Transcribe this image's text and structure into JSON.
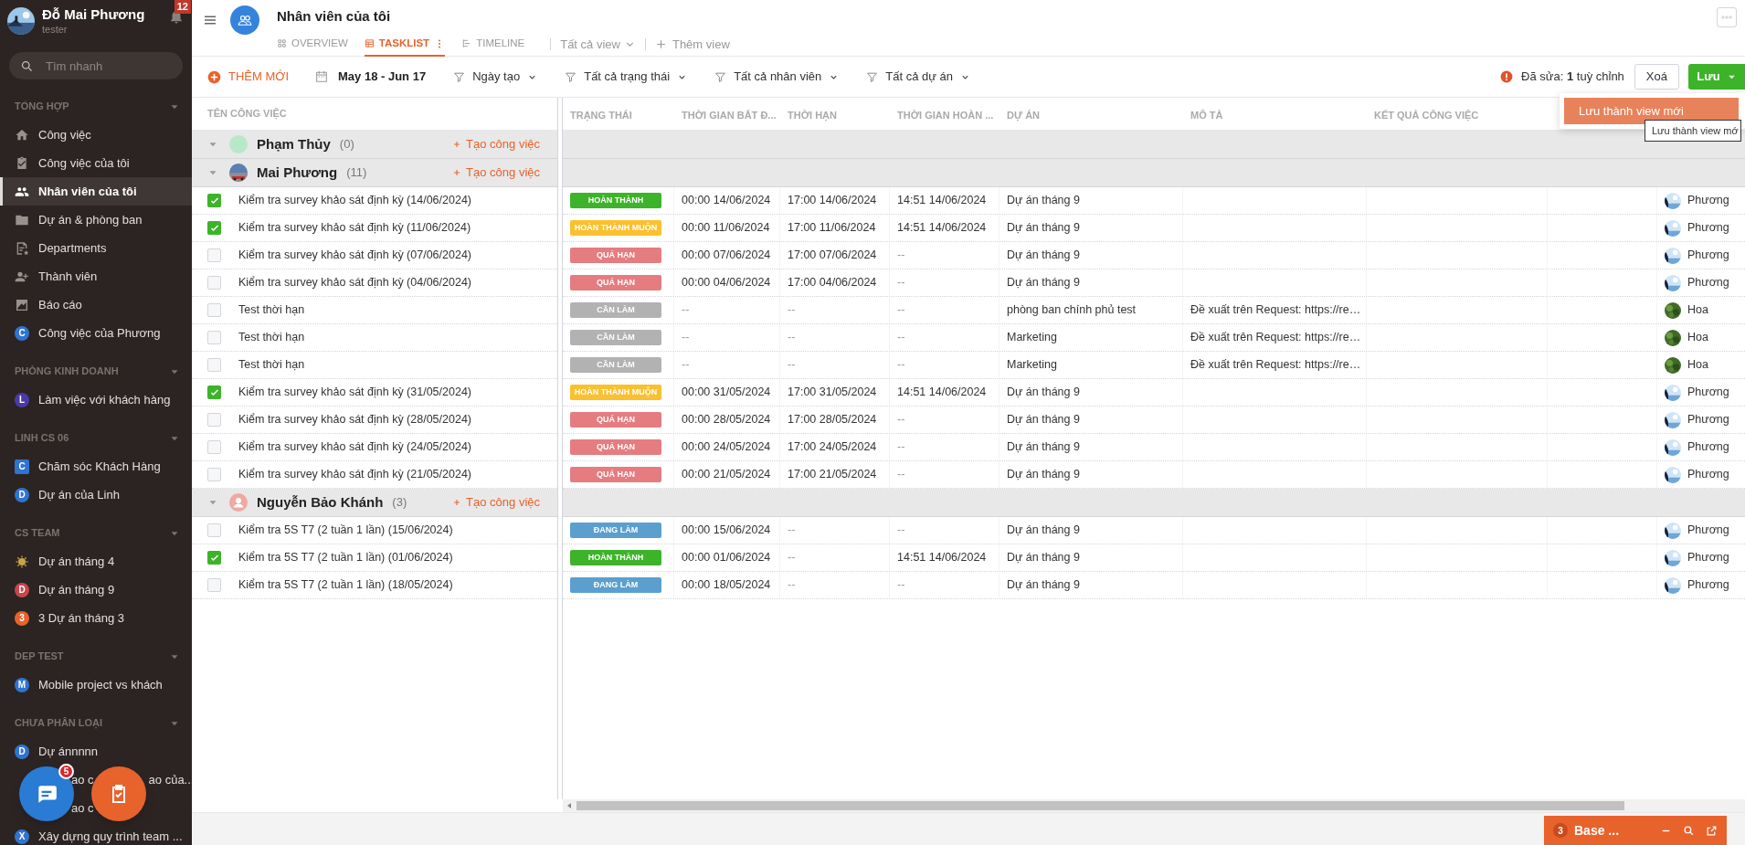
{
  "sidebar": {
    "user": {
      "name": "Đỗ Mai Phương",
      "role": "tester"
    },
    "notifications": "12",
    "search": {
      "placeholder": "Tìm nhanh"
    },
    "sections": [
      {
        "title": "TỔNG HỢP",
        "expanded": true,
        "items": [
          {
            "kind": "icon",
            "label": "Công việc",
            "selected": false
          },
          {
            "kind": "icon",
            "label": "Công việc của tôi",
            "selected": false
          },
          {
            "kind": "icon",
            "label": "Nhân viên của tôi",
            "selected": true
          },
          {
            "kind": "icon",
            "label": "Dự án & phòng ban",
            "selected": false
          },
          {
            "kind": "icon",
            "label": "Departments",
            "selected": false
          },
          {
            "kind": "icon",
            "label": "Thành viên",
            "selected": false
          },
          {
            "kind": "icon",
            "label": "Báo cáo",
            "selected": false
          },
          {
            "kind": "letter",
            "letter": "C",
            "color": "#2f74d0",
            "label": "Công việc của Phương",
            "selected": false
          }
        ]
      },
      {
        "title": "PHÒNG KINH DOANH",
        "expanded": true,
        "items": [
          {
            "kind": "letter",
            "letter": "L",
            "color": "#4a3aa8",
            "label": "Làm việc với khách hàng",
            "selected": false
          }
        ]
      },
      {
        "title": "LINH CS 06",
        "expanded": true,
        "items": [
          {
            "kind": "square",
            "letter": "C",
            "color": "#2f74d0",
            "label": "Chăm sóc Khách Hàng",
            "selected": false
          },
          {
            "kind": "letter",
            "letter": "D",
            "color": "#2f74d0",
            "label": "Dự án của Linh",
            "selected": false
          }
        ]
      },
      {
        "title": "CS TEAM",
        "expanded": true,
        "items": [
          {
            "kind": "sun",
            "label": "Dự án tháng 4",
            "selected": false
          },
          {
            "kind": "letter",
            "letter": "D",
            "color": "#c8464b",
            "label": "Dự án tháng 9",
            "selected": false
          },
          {
            "kind": "letter",
            "letter": "3",
            "color": "#e8622c",
            "label": "3 Dự án tháng 3",
            "selected": false
          }
        ]
      },
      {
        "title": "DEP TEST",
        "expanded": true,
        "items": [
          {
            "kind": "letter",
            "letter": "M",
            "color": "#2f74d0",
            "label": "Mobile project vs khách",
            "selected": false
          }
        ]
      },
      {
        "title": "CHƯA PHÂN LOẠI",
        "expanded": true,
        "items": [
          {
            "kind": "letter",
            "letter": "D",
            "color": "#2f74d0",
            "label": "Dự ánnnnn",
            "selected": false
          },
          {
            "kind": "covered",
            "fragments": [
              "ao c",
              "ao của..."
            ],
            "selected": false
          },
          {
            "kind": "covered",
            "fragments": [
              "ao c"
            ],
            "selected": false
          },
          {
            "kind": "letter",
            "letter": "X",
            "color": "#2f74d0",
            "label": "Xây dựng quy trình team ...",
            "selected": false
          }
        ]
      }
    ]
  },
  "floating": {
    "chat_badge": "5"
  },
  "header": {
    "title": "Nhân viên của tôi",
    "tabs": [
      {
        "label": "OVERVIEW",
        "selected": false
      },
      {
        "label": "TASKLIST",
        "selected": true
      },
      {
        "label": "TIMELINE",
        "selected": false
      }
    ],
    "view_menu": "Tất cả view",
    "add_view": "Thêm view"
  },
  "toolbar": {
    "add": "THÊM MỚI",
    "date_range": "May 18 - Jun 17",
    "filters": [
      "Ngày tạo",
      "Tất cả trạng thái",
      "Tất cả nhân viên",
      "Tất cả dự án"
    ],
    "edited": "Đã sửa: **1** tuỳ chỉnh",
    "clear": "Xoá",
    "save": "Lưu",
    "save_menu": [
      "Lưu thành view mới"
    ],
    "tooltip": "Lưu thành view mớ"
  },
  "table": {
    "name_column": "TÊN CÔNG VIỆC",
    "columns": [
      "TRẠNG THÁI",
      "THỜI GIAN BẮT Đ...",
      "THỜI HẠN",
      "THỜI GIAN HOÀN ...",
      "DỰ ÁN",
      "MÔ TẢ",
      "KẾT QUẢ CÔNG VIỆC"
    ],
    "groups": [
      {
        "name": "Phạm Thủy",
        "count": "(0)",
        "kind": "blank",
        "expanded": true,
        "create": "Tạo công việc"
      },
      {
        "name": "Mai Phương",
        "count": "(11)",
        "expanded": true,
        "create": "Tạo công việc",
        "tasks": [
          {
            "title": "Kiểm tra survey khảo sát định kỳ (14/06/2024)",
            "done": true,
            "status": {
              "label": "HOÀN THÀNH",
              "kind": "done"
            },
            "start": "00:00 14/06/2024",
            "deadline": "17:00 14/06/2024",
            "finished": "14:51 14/06/2024",
            "project": "Dự án tháng 9",
            "assignee": {
              "name": "Phương",
              "kind": "sky"
            }
          },
          {
            "title": "Kiểm tra survey khảo sát định kỳ (11/06/2024)",
            "done": true,
            "status": {
              "label": "HOÀN THÀNH MUỘN",
              "kind": "late"
            },
            "start": "00:00 11/06/2024",
            "deadline": "17:00 11/06/2024",
            "finished": "14:51 14/06/2024",
            "project": "Dự án tháng 9",
            "assignee": {
              "name": "Phương",
              "kind": "sky"
            }
          },
          {
            "title": "Kiểm tra survey khảo sát định kỳ (07/06/2024)",
            "done": false,
            "status": {
              "label": "QUÁ HẠN",
              "kind": "overdue"
            },
            "start": "00:00 07/06/2024",
            "deadline": "17:00 07/06/2024",
            "finished": "--",
            "project": "Dự án tháng 9",
            "assignee": {
              "name": "Phương",
              "kind": "sky"
            }
          },
          {
            "title": "Kiểm tra survey khảo sát định kỳ (04/06/2024)",
            "done": false,
            "status": {
              "label": "QUÁ HẠN",
              "kind": "overdue"
            },
            "start": "00:00 04/06/2024",
            "deadline": "17:00 04/06/2024",
            "finished": "--",
            "project": "Dự án tháng 9",
            "assignee": {
              "name": "Phương",
              "kind": "sky"
            }
          },
          {
            "title": "Test thời hạn",
            "done": false,
            "status": {
              "label": "CẦN LÀM",
              "kind": "todo"
            },
            "start": "--",
            "deadline": "--",
            "finished": "--",
            "project": "phòng ban chính phủ test",
            "description": "Đề xuất trên Request: https://re…",
            "assignee": {
              "name": "Hoa",
              "kind": "foliage"
            }
          },
          {
            "title": "Test thời hạn",
            "done": false,
            "status": {
              "label": "CẦN LÀM",
              "kind": "todo"
            },
            "start": "--",
            "deadline": "--",
            "finished": "--",
            "project": "Marketing",
            "description": "Đề xuất trên Request: https://re…",
            "assignee": {
              "name": "Hoa",
              "kind": "foliage"
            }
          },
          {
            "title": "Test thời hạn",
            "done": false,
            "status": {
              "label": "CẦN LÀM",
              "kind": "todo"
            },
            "start": "--",
            "deadline": "--",
            "finished": "--",
            "project": "Marketing",
            "description": "Đề xuất trên Request: https://re…",
            "assignee": {
              "name": "Hoa",
              "kind": "foliage"
            }
          },
          {
            "title": "Kiểm tra survey khảo sát định kỳ (31/05/2024)",
            "done": true,
            "status": {
              "label": "HOÀN THÀNH MUỘN",
              "kind": "late"
            },
            "start": "00:00 31/05/2024",
            "deadline": "17:00 31/05/2024",
            "finished": "14:51 14/06/2024",
            "project": "Dự án tháng 9",
            "assignee": {
              "name": "Phương",
              "kind": "sky"
            }
          },
          {
            "title": "Kiểm tra survey khảo sát định kỳ (28/05/2024)",
            "done": false,
            "status": {
              "label": "QUÁ HẠN",
              "kind": "overdue"
            },
            "start": "00:00 28/05/2024",
            "deadline": "17:00 28/05/2024",
            "finished": "--",
            "project": "Dự án tháng 9",
            "assignee": {
              "name": "Phương",
              "kind": "sky"
            }
          },
          {
            "title": "Kiểm tra survey khảo sát định kỳ (24/05/2024)",
            "done": false,
            "status": {
              "label": "QUÁ HẠN",
              "kind": "overdue"
            },
            "start": "00:00 24/05/2024",
            "deadline": "17:00 24/05/2024",
            "finished": "--",
            "project": "Dự án tháng 9",
            "assignee": {
              "name": "Phương",
              "kind": "sky"
            }
          },
          {
            "title": "Kiểm tra survey khảo sát định kỳ (21/05/2024)",
            "done": false,
            "status": {
              "label": "QUÁ HẠN",
              "kind": "overdue"
            },
            "start": "00:00 21/05/2024",
            "deadline": "17:00 21/05/2024",
            "finished": "--",
            "project": "Dự án tháng 9",
            "assignee": {
              "name": "Phương",
              "kind": "sky"
            }
          }
        ]
      },
      {
        "name": "Nguyễn Bảo Khánh",
        "count": "(3)",
        "kind": "silhouette",
        "expanded": true,
        "create": "Tạo công việc",
        "tasks": [
          {
            "title": "Kiểm tra 5S T7 (2 tuần 1 lần) (15/06/2024)",
            "done": false,
            "status": {
              "label": "ĐANG LÀM",
              "kind": "doing"
            },
            "start": "00:00 15/06/2024",
            "deadline": "--",
            "finished": "--",
            "project": "Dự án tháng 9",
            "assignee": {
              "name": "Phương",
              "kind": "sky"
            }
          },
          {
            "title": "Kiểm tra 5S T7 (2 tuần 1 lần) (01/06/2024)",
            "done": true,
            "status": {
              "label": "HOÀN THÀNH",
              "kind": "done"
            },
            "start": "00:00 01/06/2024",
            "deadline": "--",
            "finished": "14:51 14/06/2024",
            "project": "Dự án tháng 9",
            "assignee": {
              "name": "Phương",
              "kind": "sky"
            }
          },
          {
            "title": "Kiểm tra 5S T7 (2 tuần 1 lần) (18/05/2024)",
            "done": false,
            "status": {
              "label": "ĐANG LÀM",
              "kind": "doing"
            },
            "start": "00:00 18/05/2024",
            "deadline": "--",
            "finished": "--",
            "project": "Dự án tháng 9",
            "assignee": {
              "name": "Phương",
              "kind": "sky"
            }
          }
        ]
      }
    ]
  },
  "minimized_chat": {
    "badge": "3",
    "title": "Base ..."
  }
}
